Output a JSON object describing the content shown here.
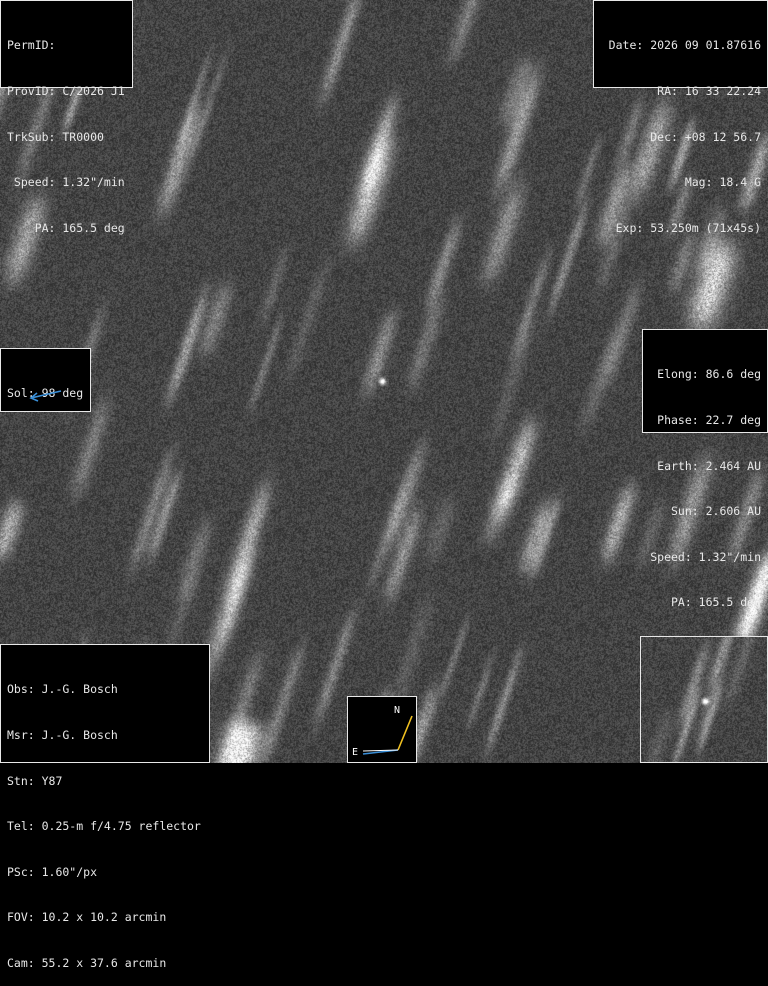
{
  "header_left": {
    "lines": [
      "PermID:",
      "ProvID: C/2026 J1",
      "TrkSub: TR0000",
      " Speed: 1.32\"/min",
      "    PA: 165.5 deg"
    ]
  },
  "header_right": {
    "lines": [
      "Date: 2026 09 01.87616",
      "RA: 16 33 22.24",
      "Dec: +08 12 56.7",
      "Mag: 18.4 G",
      "Exp: 53.250m (71x45s)"
    ]
  },
  "solar": {
    "label": "Sol: 98 deg",
    "arrow_color": "#3a8fd8"
  },
  "geometry": {
    "lines": [
      "Elong: 86.6 deg",
      "Phase: 22.7 deg",
      "Earth: 2.464 AU",
      "Sun: 2.606 AU",
      "Speed: 1.32\"/min",
      "PA: 165.5 deg"
    ]
  },
  "observer": {
    "lines": [
      "Obs: J.-G. Bosch",
      "Msr: J.-G. Bosch",
      "Stn: Y87",
      "Tel: 0.25-m f/4.75 reflector",
      "PSc: 1.60\"/px",
      "FOV: 10.2 x 10.2 arcmin",
      "Cam: 55.2 x 37.6 arcmin"
    ]
  },
  "compass": {
    "north_label": "N",
    "east_label": "E",
    "north_color": "#f0c020",
    "east_color": "#3a8fd8"
  },
  "colors": {
    "panel_border": "#e8e8e8",
    "panel_text": "#e8e8e8",
    "background": "#000000"
  }
}
